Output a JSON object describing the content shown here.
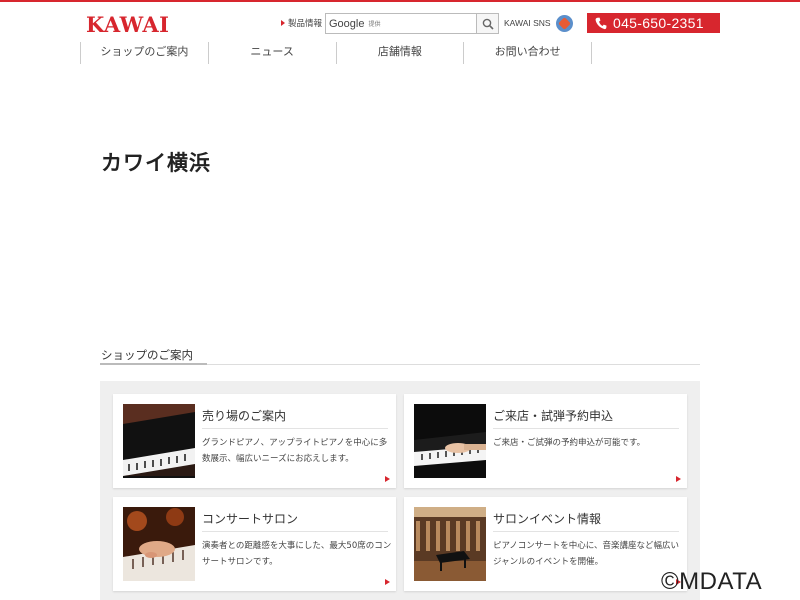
{
  "header": {
    "logo": "KAWAI",
    "product_link": "製品情報",
    "search_brand": "Google",
    "search_sub": "提供",
    "sns": "KAWAI SNS",
    "phone": "045-650-2351"
  },
  "nav": {
    "items": [
      {
        "label": "ショップのご案内"
      },
      {
        "label": "ニュース"
      },
      {
        "label": "店舗情報"
      },
      {
        "label": "お問い合わせ"
      }
    ]
  },
  "page": {
    "title": "カワイ横浜",
    "section_title": "ショップのご案内"
  },
  "cards": [
    {
      "title": "売り場のご案内",
      "desc": "グランドピアノ、アップライトピアノを中心に多数展示、幅広いニーズにお応えします。"
    },
    {
      "title": "ご来店・試弾予約申込",
      "desc": "ご来店・ご試弾の予約申込が可能です。"
    },
    {
      "title": "コンサートサロン",
      "desc": "演奏者との距離感を大事にした、最大50席のコンサートサロンです。"
    },
    {
      "title": "サロンイベント情報",
      "desc": "ピアノコンサートを中心に、音楽講座など幅広いジャンルのイベントを開催。"
    }
  ],
  "watermark": "©MDATA",
  "colors": {
    "brand": "#d7262e",
    "panel": "#efefef"
  }
}
